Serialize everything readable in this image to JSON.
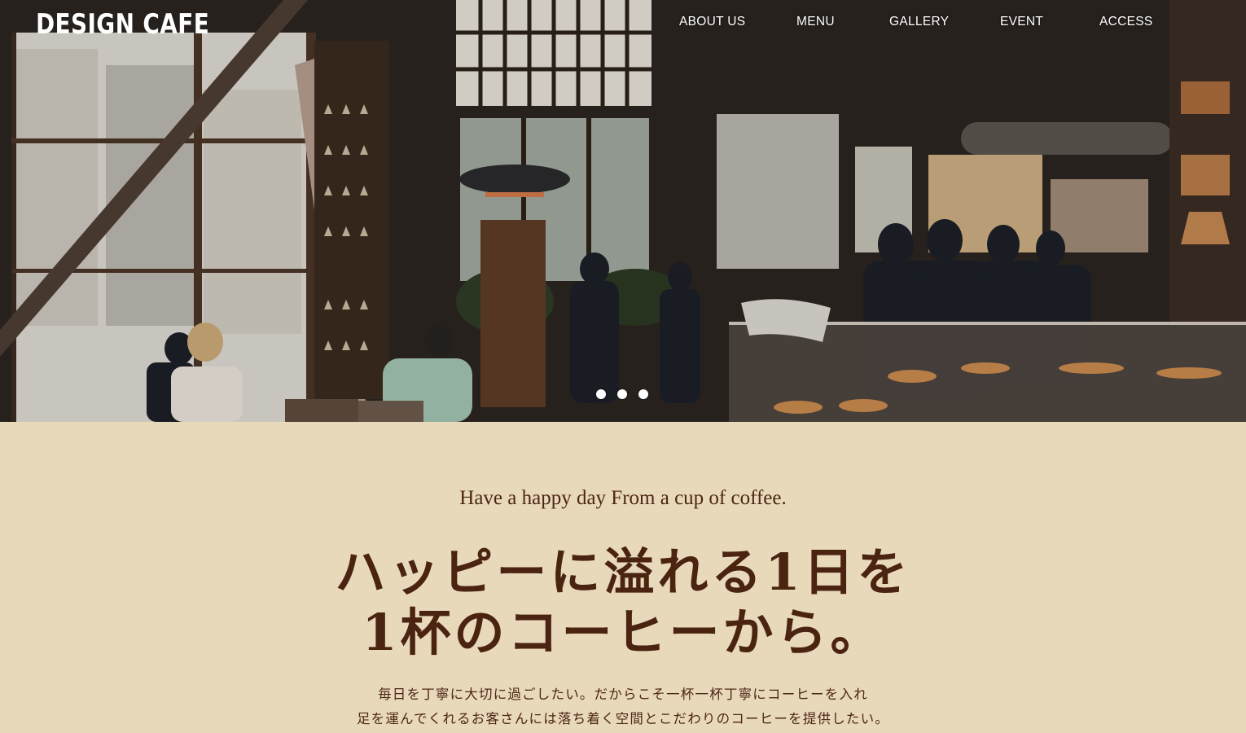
{
  "header": {
    "logo": "DESIGN CAFE",
    "nav": [
      "ABOUT US",
      "MENU",
      "GALLERY",
      "EVENT",
      "ACCESS"
    ]
  },
  "hero": {
    "slide_count": 3,
    "active_slide": 1
  },
  "intro": {
    "tagline": "Have a happy day From a cup of coffee.",
    "headline_line1": "ハッピーに溢れる1日を",
    "headline_line2": "1杯のコーヒーから。",
    "body_line1": "毎日を丁寧に大切に過ごしたい。だからこそ一杯一杯丁寧にコーヒーを入れ",
    "body_line2": "足を運んでくれるお客さんには落ち着く空間とこだわりのコーヒーを提供したい。"
  },
  "colors": {
    "background": "#e9d9bb",
    "text_brown": "#4c2714",
    "nav_text": "#ffffff"
  }
}
